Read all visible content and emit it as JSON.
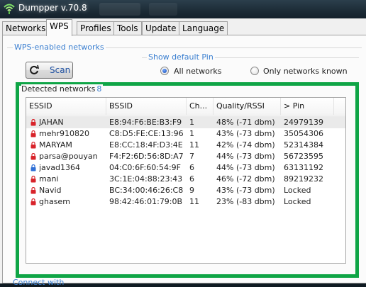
{
  "window": {
    "title": "Dumpper v.70.8"
  },
  "tabs": [
    {
      "label": "Networks",
      "active": false
    },
    {
      "label": "WPS",
      "active": true
    },
    {
      "label": "Profiles",
      "active": false
    },
    {
      "label": "Tools",
      "active": false
    },
    {
      "label": "Update",
      "active": false
    },
    {
      "label": "Language",
      "active": false
    }
  ],
  "wps": {
    "group_title": "WPS-enabled networks",
    "scan_label": "Scan",
    "show_default_pin": {
      "title": "Show default Pin",
      "options": [
        {
          "label": "All networks",
          "selected": true
        },
        {
          "label": "Only networks known",
          "selected": false
        }
      ]
    },
    "detected": {
      "label": "Detected networks",
      "count": "8",
      "columns": [
        "ESSID",
        "BSSID",
        "Ch...",
        "Quality/RSSI",
        "> Pin"
      ],
      "rows": [
        {
          "essid": "JAHAN",
          "bssid": "E8:94:F6:BE:B3:F9",
          "channel": "1",
          "quality": "48% (-71 dbm)",
          "pin": "24979139",
          "icon": "red-lock-icon",
          "selected": true
        },
        {
          "essid": "mehr910820",
          "bssid": "C8:D5:FE:CE:13:96",
          "channel": "1",
          "quality": "43% (-73 dbm)",
          "pin": "35054306",
          "icon": "red-lock-icon",
          "selected": false
        },
        {
          "essid": "MARYAM",
          "bssid": "E8:CC:18:4F:D3:4E",
          "channel": "11",
          "quality": "42% (-74 dbm)",
          "pin": "52314384",
          "icon": "red-lock-icon",
          "selected": false
        },
        {
          "essid": "parsa@pouyan",
          "bssid": "F4:F2:6D:56:8D:A7",
          "channel": "7",
          "quality": "44% (-73 dbm)",
          "pin": "56723595",
          "icon": "red-lock-icon",
          "selected": false
        },
        {
          "essid": "javad1364",
          "bssid": "04:C0:6F:60:54:9F",
          "channel": "6",
          "quality": "44% (-73 dbm)",
          "pin": "63131192",
          "icon": "blue-lock-icon",
          "selected": false
        },
        {
          "essid": "mani",
          "bssid": "3C:1E:04:88:23:43",
          "channel": "6",
          "quality": "46% (-72 dbm)",
          "pin": "89219232",
          "icon": "red-lock-icon",
          "selected": false
        },
        {
          "essid": "Navid",
          "bssid": "BC:34:00:46:26:C8",
          "channel": "9",
          "quality": "43% (-73 dbm)",
          "pin": "Locked",
          "icon": "red-lock-icon",
          "selected": false
        },
        {
          "essid": "ghasem",
          "bssid": "98:42:46:01:79:0B",
          "channel": "11",
          "quality": "23% (-83 dbm)",
          "pin": "Locked",
          "icon": "red-lock-icon",
          "selected": false
        }
      ]
    },
    "bottom_group_title": "Connect with"
  },
  "colors": {
    "accent_blue": "#3b7fd0",
    "highlight_green": "#0fa546",
    "lock_red": "#d8232a",
    "lock_blue": "#2f6fd6"
  }
}
